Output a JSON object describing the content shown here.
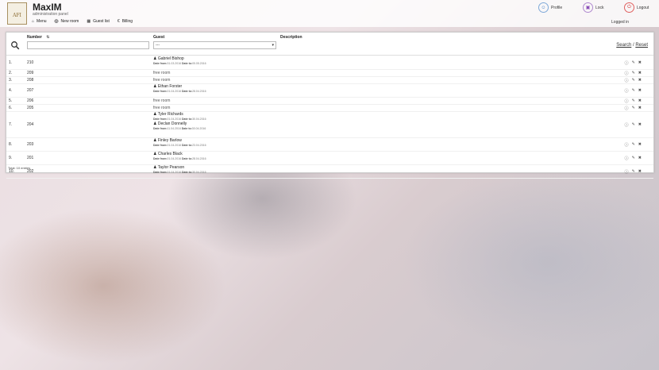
{
  "app": {
    "title": "MaxIM",
    "subtitle": "administration panel",
    "logo_text": "AFI"
  },
  "nav": [
    {
      "label": "Menu",
      "icon": "home-icon"
    },
    {
      "label": "New room",
      "icon": "plus-icon"
    },
    {
      "label": "Guest list",
      "icon": "list-icon"
    },
    {
      "label": "Billing",
      "icon": "euro-icon"
    }
  ],
  "top_actions": {
    "profile": "Profile",
    "lock": "Lock",
    "logout": "Logout"
  },
  "user_status": "Logged in",
  "filters": {
    "number_header": "Number",
    "guest_header": "Guest",
    "description_header": "Description",
    "guest_select_value": "---",
    "search_link": "Search",
    "separator": "/",
    "reset_link": "Reset"
  },
  "rooms": [
    {
      "index": "1.",
      "number": "210",
      "guests": [
        {
          "name": "Gabriel Bishop",
          "from": "31.03.2016",
          "to": "05.05.2016"
        }
      ]
    },
    {
      "index": "2.",
      "number": "209",
      "free": "free room"
    },
    {
      "index": "3.",
      "number": "208",
      "free": "free room"
    },
    {
      "index": "4.",
      "number": "207",
      "guests": [
        {
          "name": "Ethan Forster",
          "from": "01.04.2016",
          "to": "28.04.2016"
        }
      ]
    },
    {
      "index": "5.",
      "number": "206",
      "free": "free room"
    },
    {
      "index": "6.",
      "number": "205",
      "free": "free room"
    },
    {
      "index": "7.",
      "number": "204",
      "guests": [
        {
          "name": "Tyler Richards",
          "from": "01.04.2016",
          "to": "30.04.2016"
        },
        {
          "name": "Declan Donnelly",
          "from": "11.04.2016",
          "to": "30.04.2016"
        }
      ]
    },
    {
      "index": "8.",
      "number": "203",
      "guests": [
        {
          "name": "Finley Barlow",
          "from": "01.04.2016",
          "to": "23.04.2016"
        }
      ]
    },
    {
      "index": "9.",
      "number": "201",
      "guests": [
        {
          "name": "Charles Black",
          "from": "01.04.2016",
          "to": "28.04.2016"
        }
      ]
    },
    {
      "index": "10.",
      "number": "202",
      "guests": [
        {
          "name": "Taylor Pearson",
          "from": "01.04.2016",
          "to": "30.04.2016"
        }
      ]
    }
  ],
  "labels": {
    "date_from": "Date from:",
    "date_to": "Date to:"
  },
  "total": "Total: 10 entries"
}
